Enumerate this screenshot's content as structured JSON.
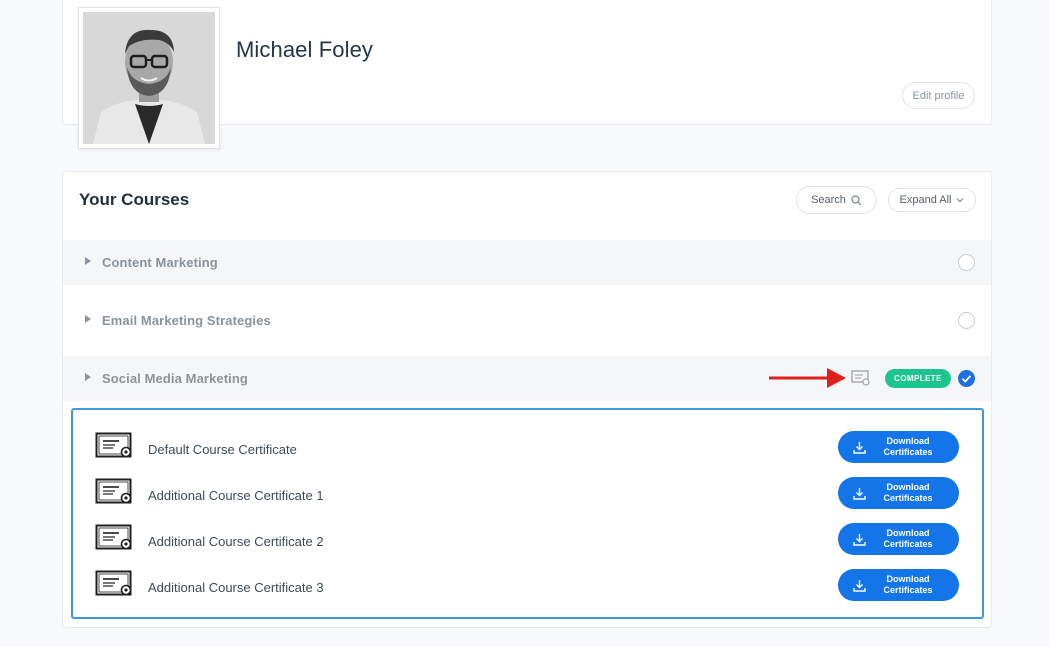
{
  "profile": {
    "name": "Michael Foley",
    "edit_label": "Edit profile"
  },
  "courses": {
    "title": "Your Courses",
    "search_label": "Search",
    "expand_label": "Expand All",
    "items": [
      {
        "label": "Content Marketing",
        "complete": false
      },
      {
        "label": "Email Marketing Strategies",
        "complete": false
      },
      {
        "label": "Social Media Marketing",
        "complete": true,
        "badge": "COMPLETE"
      }
    ]
  },
  "certificates": {
    "button_label_line1": "Download",
    "button_label_line2": "Certificates",
    "items": [
      {
        "label": "Default Course Certificate"
      },
      {
        "label": "Additional Course Certificate 1"
      },
      {
        "label": "Additional Course Certificate 2"
      },
      {
        "label": "Additional Course Certificate 3"
      }
    ]
  },
  "colors": {
    "accent_blue": "#1375e8",
    "complete_green": "#1ec48e",
    "arrow_red": "#e0201c",
    "panel_border": "#3d9ad6"
  }
}
